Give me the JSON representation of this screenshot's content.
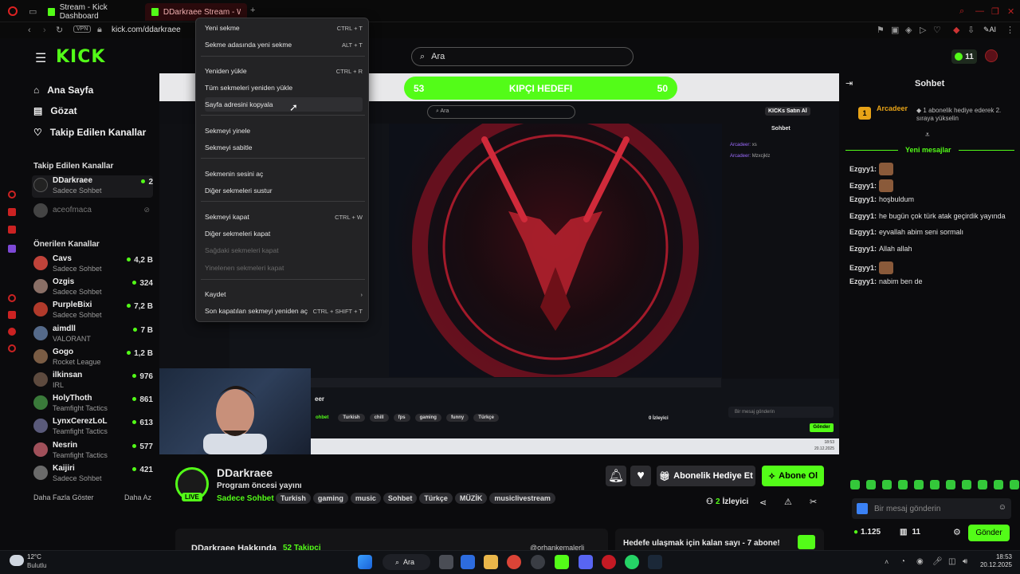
{
  "browser": {
    "tabs": [
      {
        "label": "Stream - Kick Dashboard"
      },
      {
        "label": "DDarkraee Stream - Wat"
      }
    ],
    "url": "kick.com/ddarkraee",
    "vpn": "VPN",
    "ai_label": "AI"
  },
  "header": {
    "logo": "KICK",
    "search_placeholder": "Ara",
    "kicks_count": "11"
  },
  "sidebar": {
    "nav": [
      {
        "label": "Ana Sayfa",
        "icon": "home-icon"
      },
      {
        "label": "Gözat",
        "icon": "browse-icon"
      },
      {
        "label": "Takip Edilen Kanallar",
        "icon": "heart-icon"
      }
    ],
    "followed_title": "Takip Edilen Kanallar",
    "followed": [
      {
        "name": "DDarkraee",
        "category": "Sadece Sohbet",
        "viewers": "2"
      },
      {
        "name": "aceofmaca",
        "category": "",
        "viewers": ""
      }
    ],
    "recommended_title": "Önerilen Kanallar",
    "recommended": [
      {
        "name": "Cavs",
        "category": "Sadece Sohbet",
        "viewers": "4,2 B",
        "color": "#c0433a"
      },
      {
        "name": "Ozgis",
        "category": "Sadece Sohbet",
        "viewers": "324",
        "color": "#8a6f66"
      },
      {
        "name": "PurpleBixi",
        "category": "Sadece Sohbet",
        "viewers": "7,2 B",
        "color": "#b13a2b"
      },
      {
        "name": "aimdll",
        "category": "VALORANT",
        "viewers": "7 B",
        "color": "#556a8a"
      },
      {
        "name": "Gogo",
        "category": "Rocket League",
        "viewers": "1,2 B",
        "color": "#7a5c44"
      },
      {
        "name": "ilkinsan",
        "category": "IRL",
        "viewers": "976",
        "color": "#5d4a3e"
      },
      {
        "name": "HolyThoth",
        "category": "Teamfight Tactics",
        "viewers": "861",
        "color": "#3a7a3a"
      },
      {
        "name": "LynxCerezLoL",
        "category": "Teamfight Tactics",
        "viewers": "613",
        "color": "#5a5a7a"
      },
      {
        "name": "Nesrin",
        "category": "Teamfight Tactics",
        "viewers": "577",
        "color": "#a0505a"
      },
      {
        "name": "Kaijiri",
        "category": "Sadece Sohbet",
        "viewers": "421",
        "color": "#6a6a6a"
      }
    ],
    "show_more": "Daha Fazla Göster",
    "show_less": "Daha Az"
  },
  "context_menu": {
    "items": [
      {
        "label": "Yeni sekme",
        "shortcut": "CTRL + T",
        "disabled": false
      },
      {
        "label": "Sekme adasında yeni sekme",
        "shortcut": "ALT + T",
        "disabled": false
      },
      {
        "label": "Yeniden yükle",
        "shortcut": "CTRL + R",
        "disabled": false
      },
      {
        "label": "Tüm sekmeleri yeniden yükle",
        "shortcut": "",
        "disabled": false
      },
      {
        "label": "Sayfa adresini kopyala",
        "shortcut": "",
        "disabled": false
      },
      {
        "label": "Sekmeyi yinele",
        "shortcut": "",
        "disabled": false
      },
      {
        "label": "Sekmeyi sabitle",
        "shortcut": "",
        "disabled": false
      },
      {
        "label": "Sekmenin sesini aç",
        "shortcut": "",
        "disabled": false
      },
      {
        "label": "Diğer sekmeleri sustur",
        "shortcut": "",
        "disabled": false
      },
      {
        "label": "Sekmeyi kapat",
        "shortcut": "CTRL + W",
        "disabled": false
      },
      {
        "label": "Diğer sekmeleri kapat",
        "shortcut": "",
        "disabled": false
      },
      {
        "label": "Sağdaki sekmeleri kapat",
        "shortcut": "",
        "disabled": true
      },
      {
        "label": "Yinelenen sekmeleri kapat",
        "shortcut": "",
        "disabled": true
      },
      {
        "label": "Kaydet",
        "shortcut": "›",
        "disabled": false
      },
      {
        "label": "Son kapatılan sekmeyi yeniden aç",
        "shortcut": "CTRL + SHIFT + T",
        "disabled": false
      }
    ]
  },
  "goal": {
    "left": "53",
    "title": "KIPÇI HEDEFI",
    "right": "50"
  },
  "inner": {
    "search": "Ara",
    "buy_kicks": "KICKs Satın Al",
    "chat_title": "Sohbet",
    "messages": [
      {
        "user": "Arcadeer:",
        "text": "xs"
      },
      {
        "user": "Arcadeer:",
        "text": "Mzxcjklz"
      }
    ],
    "chat_placeholder": "Bir mesaj gönderin",
    "send": "Gönder",
    "viewers": "0 İzleyici",
    "streamer_partial": "eer",
    "tags": [
      "ohbet",
      "Turkish",
      "chill",
      "fps",
      "gaming",
      "funny",
      "Türkçe"
    ],
    "taskbar_time": "18:53",
    "taskbar_date": "20.12.2025"
  },
  "stream": {
    "live_badge": "LIVE",
    "name": "DDarkraee",
    "title": "Program öncesi yayını",
    "category": "Sadece Sohbet",
    "tags": [
      "Turkish",
      "gaming",
      "music",
      "Sohbet",
      "Türkçe",
      "MÜZİK",
      "musiclivestream"
    ],
    "gift_label": "Abonelik Hediye Et",
    "subscribe_label": "Abone Ol",
    "viewers": "2",
    "viewers_suffix": "İzleyici",
    "about": "DDarkraee Hakkında",
    "followers": "52 Takipçi",
    "social": "@orhankemalerli",
    "goal_text": "Hedefe ulaşmak için kalan sayı - 7 abone!"
  },
  "chat": {
    "title": "Sohbet",
    "pinned_user": "Arcadeer",
    "pinned_rank": "1",
    "pinned_text": "1 abonelik hediye ederek 2. sıraya yükselin",
    "new_messages": "Yeni mesajlar",
    "messages": [
      {
        "user": "Ezgyy1:",
        "text": ""
      },
      {
        "user": "Ezgyy1:",
        "text": ""
      },
      {
        "user": "Ezgyy1:",
        "text": "hoşbuldum"
      },
      {
        "user": "Ezgyy1:",
        "text": "he bugün çok türk atak geçirdik yayında"
      },
      {
        "user": "Ezgyy1:",
        "text": "eyvallah abim seni sormalı"
      },
      {
        "user": "Ezgyy1:",
        "text": "Allah allah"
      },
      {
        "user": "Ezgyy1:",
        "text": ""
      },
      {
        "user": "Ezgyy1:",
        "text": "nabim ben de"
      }
    ],
    "input_placeholder": "Bir mesaj gönderin",
    "points": "1.125",
    "gifts": "11",
    "send_label": "Gönder"
  },
  "taskbar": {
    "temp": "12°C",
    "weather": "Bulutlu",
    "search": "Ara",
    "time": "18:53",
    "date": "20.12.2025"
  }
}
